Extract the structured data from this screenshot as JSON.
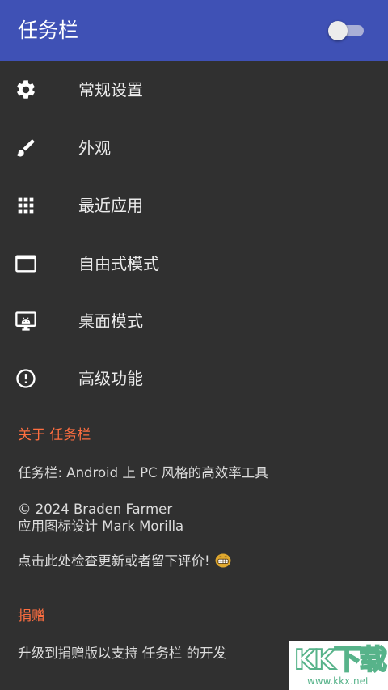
{
  "appbar": {
    "title": "任务栏",
    "toggle_on": false,
    "color": "#3f51b5"
  },
  "menu": [
    {
      "label": "常规设置",
      "icon": "gear-icon"
    },
    {
      "label": "外观",
      "icon": "paintbrush-icon"
    },
    {
      "label": "最近应用",
      "icon": "grid-apps-icon"
    },
    {
      "label": "自由式模式",
      "icon": "window-icon"
    },
    {
      "label": "桌面模式",
      "icon": "desktop-monitor-icon"
    },
    {
      "label": "高级功能",
      "icon": "exclamation-circle-icon"
    }
  ],
  "about": {
    "header": "关于 任务栏",
    "description": "任务栏: Android 上 PC 风格的高效率工具",
    "copyright": "© 2024 Braden Farmer",
    "icon_design": "应用图标设计 Mark Morilla",
    "check_update": "点击此处检查更新或者留下评价!"
  },
  "donate": {
    "header": "捐赠",
    "text": "升级到捐赠版以支持 任务栏 的开发"
  },
  "watermark": {
    "logo_text": "KK下载",
    "url": "www.kkx.net"
  },
  "colors": {
    "background": "#303030",
    "accent": "#ff6e40",
    "text_primary": "#ececec",
    "text_secondary": "#dcdcdc"
  }
}
